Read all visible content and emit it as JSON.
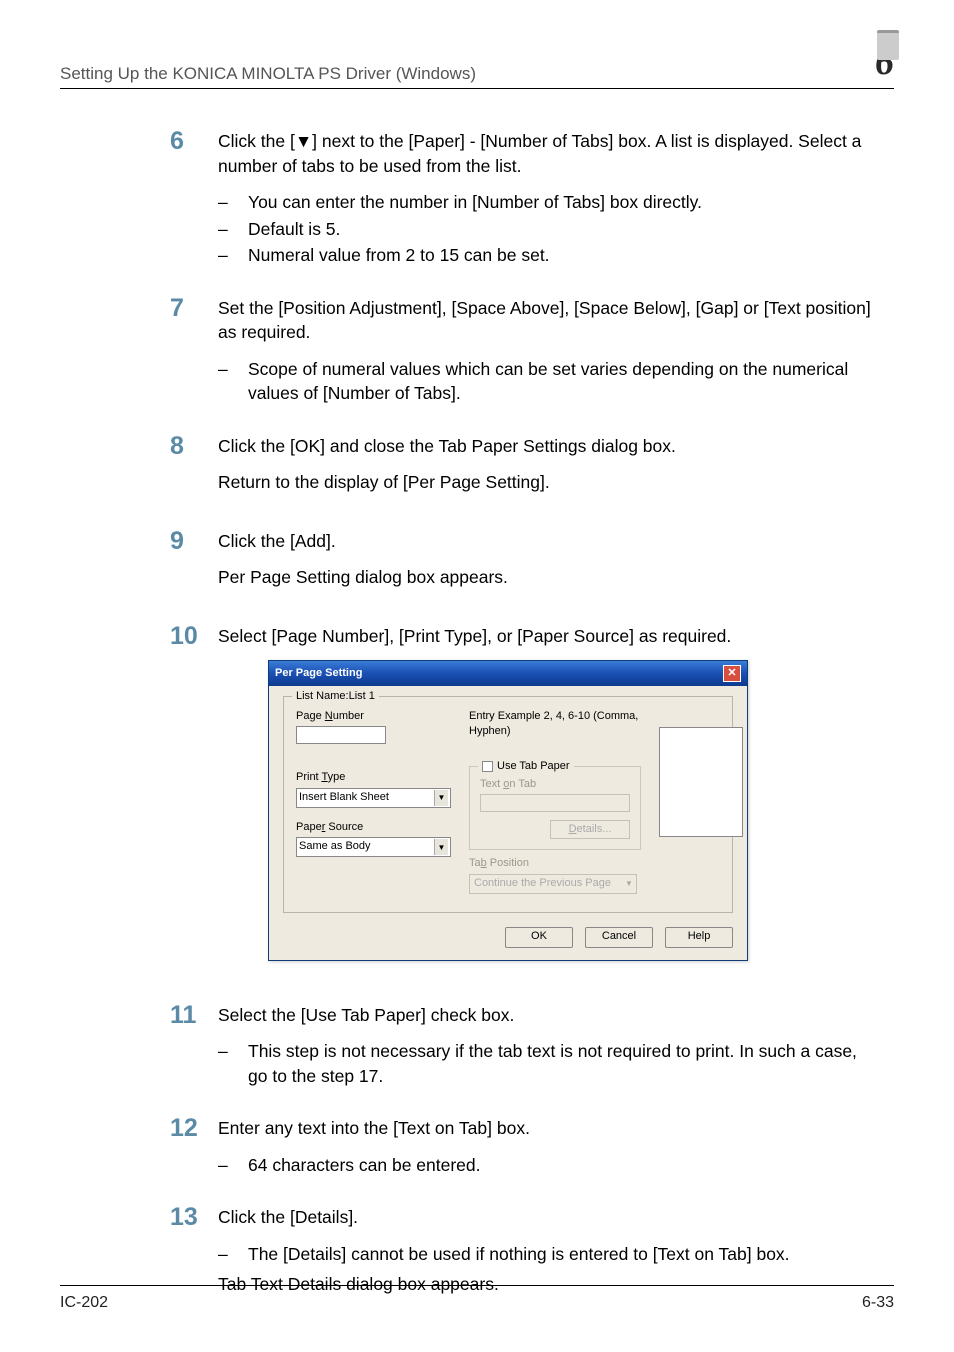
{
  "header": {
    "title": "Setting Up the KONICA MINOLTA PS Driver (Windows)",
    "chapter": "6"
  },
  "steps": {
    "s6": {
      "num": "6",
      "text": "Click the [▼] next to the [Paper] - [Number of Tabs] box. A list is displayed. Select a number of tabs to be used from the list.",
      "items": [
        "You can enter the number in [Number of Tabs] box directly.",
        "Default is 5.",
        "Numeral value from 2 to 15 can be set."
      ]
    },
    "s7": {
      "num": "7",
      "text": "Set the [Position Adjustment], [Space Above], [Space Below], [Gap] or [Text position] as required.",
      "items": [
        "Scope of numeral values which can be set varies depending on the numerical values of [Number of Tabs]."
      ]
    },
    "s8": {
      "num": "8",
      "text": "Click the [OK] and close the Tab Paper Settings dialog box.",
      "text2": "Return to the display of [Per Page Setting]."
    },
    "s9": {
      "num": "9",
      "text": "Click the [Add].",
      "text2": "Per Page Setting dialog box appears."
    },
    "s10": {
      "num": "10",
      "text": "Select [Page Number], [Print Type], or [Paper Source] as required."
    },
    "s11": {
      "num": "11",
      "text": "Select the [Use Tab Paper] check box.",
      "items": [
        "This step is not necessary if the tab text is not required to print. In such a case, go to the step 17."
      ]
    },
    "s12": {
      "num": "12",
      "text": "Enter any text into the [Text on Tab] box.",
      "items": [
        "64 characters can be entered."
      ]
    },
    "s13": {
      "num": "13",
      "text": "Click the [Details].",
      "items": [
        "The [Details] cannot be used if nothing is entered to [Text on Tab] box."
      ],
      "text2": "Tab Text Details dialog box appears."
    }
  },
  "dialog": {
    "title": "Per Page Setting",
    "legend": "List Name:List 1",
    "pageNumLabel": "Page Number",
    "pageNumUL": "N",
    "hint": "Entry Example 2, 4, 6-10 (Comma, Hyphen)",
    "printTypeLabel": "Print Type",
    "printTypeUL": "T",
    "printTypeVal": "Insert Blank Sheet",
    "paperSourceLabel": "Paper Source",
    "paperSourceUL": "r",
    "paperSourceVal": "Same as Body",
    "useTabLabel": "Use Tab Paper",
    "useTabUL": "U",
    "textOnTabLabel": "Text on Tab",
    "textOnTabUL": "o",
    "detailsLabel": "Details...",
    "detailsUL": "D",
    "tabPosLabel": "Tab Position",
    "tabPosUL": "b",
    "tabPosVal": "Continue the Previous Page",
    "ok": "OK",
    "cancel": "Cancel",
    "help": "Help"
  },
  "footer": {
    "left": "IC-202",
    "right": "6-33"
  }
}
